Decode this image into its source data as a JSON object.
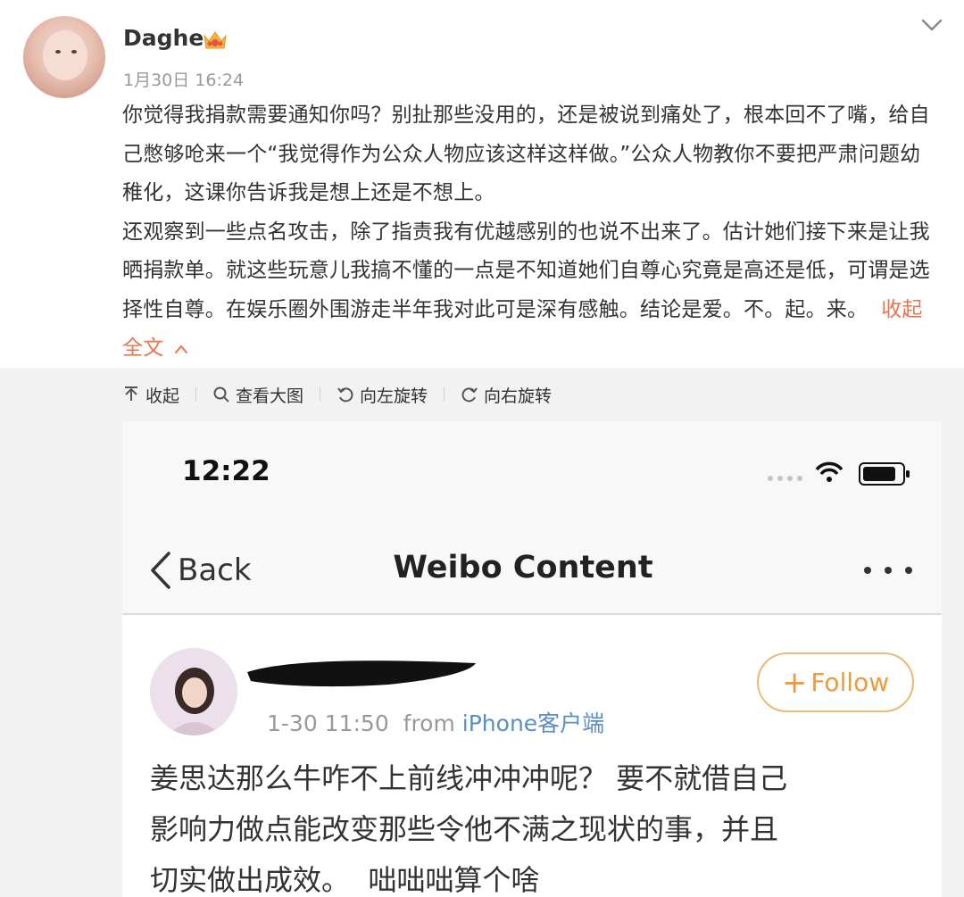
{
  "post": {
    "username": "Daghe",
    "timestamp": "1月30日 16:24",
    "paragraphs": [
      "你觉得我捐款需要通知你吗？别扯那些没用的，还是被说到痛处了，根本回不了嘴，给自己憋够呛来一个“我觉得作为公众人物应该这样这样做。”公众人物教你不要把严肃问题幼稚化，这课你告诉我是想上还是不想上。",
      "还观察到一些点名攻击，除了指责我有优越感别的也说不出来了。估计她们接下来是让我晒捐款单。就这些玩意儿我搞不懂的一点是不知道她们自尊心究竟是高还是低，可谓是选择性自尊。在娱乐圈外围游走半年我对此可是深有感触。结论是爱。不。起。来。"
    ],
    "collapse_label": "收起全文",
    "accent_color": "#eb7350"
  },
  "toolbar": {
    "collapse": "收起",
    "view_large": "查看大图",
    "rotate_left": "向左旋转",
    "rotate_right": "向右旋转"
  },
  "screenshot": {
    "status_time": "12:22",
    "back_label": "Back",
    "nav_title": "Weibo Content",
    "follow_label": "Follow",
    "meta_time": "1-30 11:50",
    "meta_from": "from",
    "meta_source": "iPhone客户端",
    "content_lines": [
      "姜思达那么牛咋不上前线冲冲冲呢？ 要不就借自己",
      "影响力做点能改变那些令他不满之现状的事，并且",
      "切实做出成效。  咄咄咄算个啥"
    ],
    "follow_color": "#ee9a3e",
    "source_color": "#5b8ec5"
  }
}
